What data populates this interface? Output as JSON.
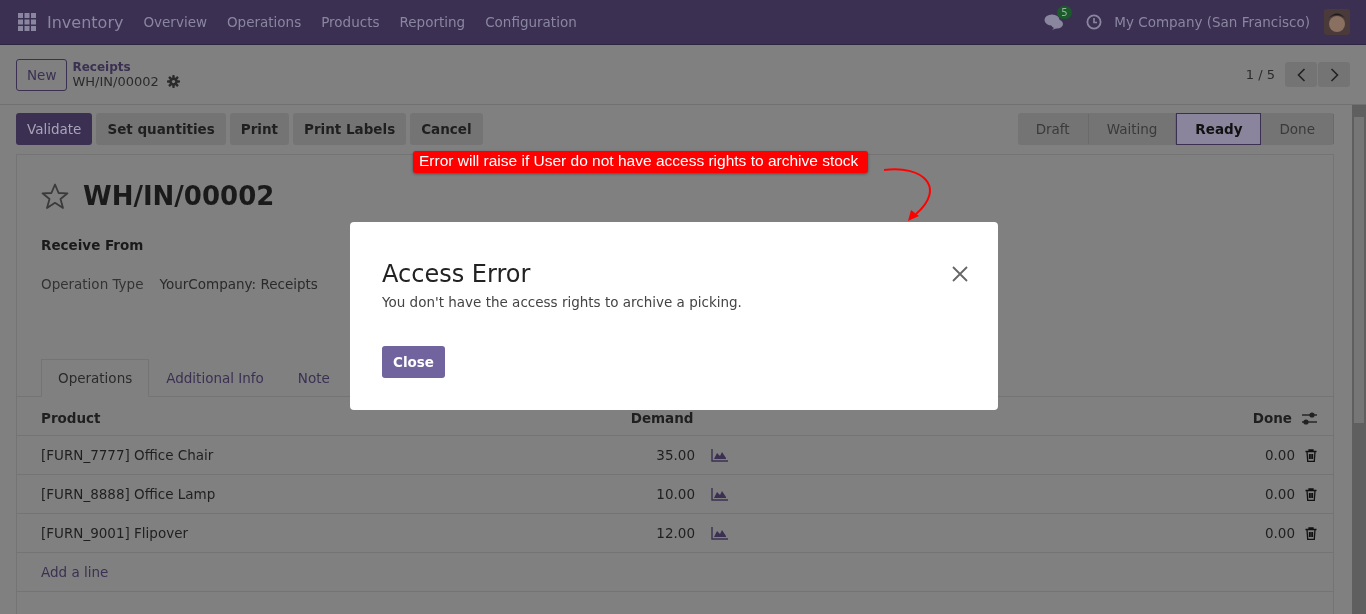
{
  "navbar": {
    "app_name": "Inventory",
    "menu": [
      "Overview",
      "Operations",
      "Products",
      "Reporting",
      "Configuration"
    ],
    "messages_badge": "5",
    "company": "My Company (San Francisco)"
  },
  "control_panel": {
    "new_button": "New",
    "breadcrumb": "Receipts",
    "record_name": "WH/IN/00002",
    "pager": "1 / 5"
  },
  "actions": [
    {
      "label": "Validate",
      "kind": "primary"
    },
    {
      "label": "Set quantities",
      "kind": "secondary"
    },
    {
      "label": "Print",
      "kind": "secondary"
    },
    {
      "label": "Print Labels",
      "kind": "secondary"
    },
    {
      "label": "Cancel",
      "kind": "secondary"
    }
  ],
  "status_bar": [
    {
      "label": "Draft",
      "selected": false
    },
    {
      "label": "Waiting",
      "selected": false
    },
    {
      "label": "Ready",
      "selected": true
    },
    {
      "label": "Done",
      "selected": false
    }
  ],
  "form": {
    "title": "WH/IN/00002",
    "starred": false,
    "fields": [
      {
        "label": "Receive From"
      },
      {
        "label": "Operation Type",
        "value": "YourCompany: Receipts"
      }
    ]
  },
  "tabs": [
    {
      "label": "Operations",
      "selected": true
    },
    {
      "label": "Additional Info",
      "selected": false
    },
    {
      "label": "Note",
      "selected": false
    }
  ],
  "table": {
    "columns": [
      "Product",
      "Demand",
      "Done"
    ],
    "rows": [
      {
        "product": "[FURN_7777] Office Chair",
        "demand": "35.00",
        "done": "0.00"
      },
      {
        "product": "[FURN_8888] Office Lamp",
        "demand": "10.00",
        "done": "0.00"
      },
      {
        "product": "[FURN_9001] Flipover",
        "demand": "12.00",
        "done": "0.00"
      }
    ],
    "add_line": "Add a line"
  },
  "annotation": "Error will raise if User do not have access rights to archive stock",
  "dialog": {
    "title": "Access Error",
    "message": "You don't have the access rights to archive a picking.",
    "button": "Close"
  }
}
